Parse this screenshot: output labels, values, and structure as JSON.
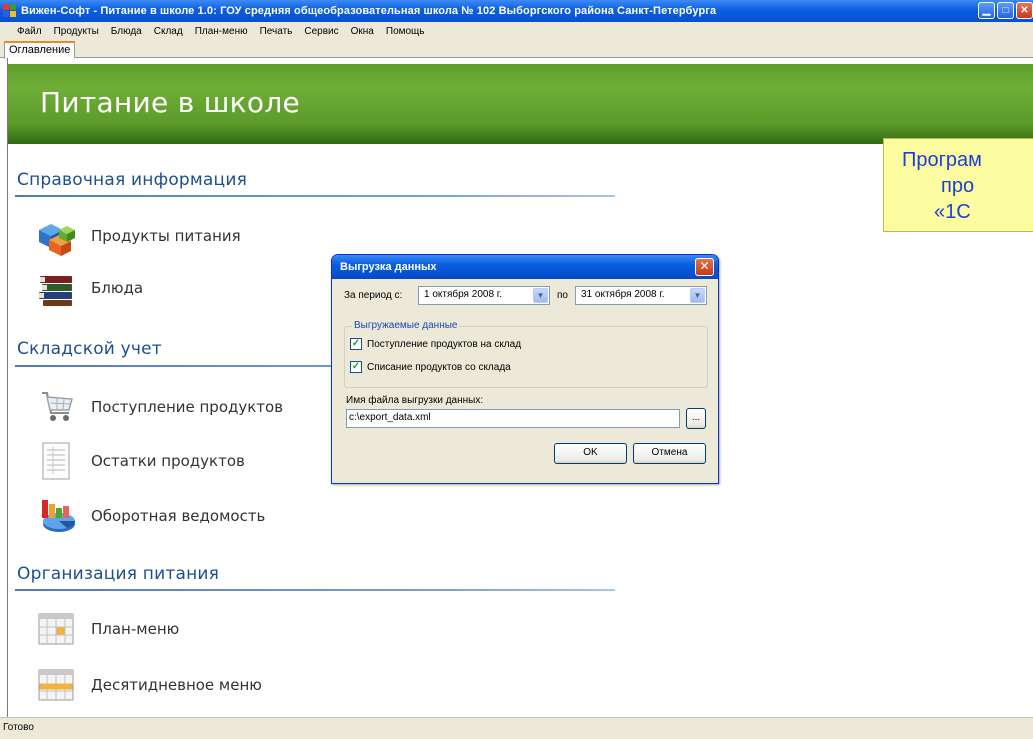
{
  "window": {
    "title": "Вижен-Софт - Питание в школе 1.0: ГОУ средняя общеобразовательная школа № 102 Выборгского района Санкт-Петербурга"
  },
  "menu": {
    "items": [
      "Файл",
      "Продукты",
      "Блюда",
      "Склад",
      "План-меню",
      "Печать",
      "Сервис",
      "Окна",
      "Помощь"
    ]
  },
  "tabs": [
    {
      "label": "Оглавление",
      "active": true
    }
  ],
  "banner": {
    "title": "Питание в школе"
  },
  "sections": [
    {
      "heading": "Справочная информация",
      "items": [
        {
          "label": "Продукты питания",
          "icon": "product-cubes-icon"
        },
        {
          "label": "Блюда",
          "icon": "books-icon"
        }
      ]
    },
    {
      "heading": "Складской учет",
      "items": [
        {
          "label": "Поступление продуктов",
          "icon": "shopping-cart-icon"
        },
        {
          "label": "Остатки продуктов",
          "icon": "document-list-icon"
        },
        {
          "label": "Оборотная ведомость",
          "icon": "bar-pie-chart-icon"
        }
      ]
    },
    {
      "heading": "Организация питания",
      "items": [
        {
          "label": "План-меню",
          "icon": "calendar-grid-icon"
        },
        {
          "label": "Десятидневное меню",
          "icon": "calendar-table-icon"
        }
      ]
    }
  ],
  "callout": {
    "lines": [
      "Програм",
      "про",
      "«1С"
    ]
  },
  "dialog": {
    "title": "Выгрузка данных",
    "period_label": "За период с:",
    "date_from": "1  октября  2008 г.",
    "to_label": "по",
    "date_to": "31  октября  2008 г.",
    "group_legend": "Выгружаемые данные",
    "checkboxes": [
      {
        "label": "Поступление продуктов на склад",
        "checked": true
      },
      {
        "label": "Списание продуктов со склада",
        "checked": true
      }
    ],
    "file_label": "Имя файла выгрузки данных:",
    "file_value": "c:\\export_data.xml",
    "browse_label": "...",
    "ok_label": "OK",
    "cancel_label": "Отмена"
  },
  "status": {
    "text": "Готово"
  },
  "colors": {
    "banner_green": "#6fae36",
    "section_blue": "#1d4f8e",
    "callout_yellow": "#fbfba0",
    "callout_text": "#1e3fd6",
    "xp_title_blue": "#0a5fe0"
  }
}
